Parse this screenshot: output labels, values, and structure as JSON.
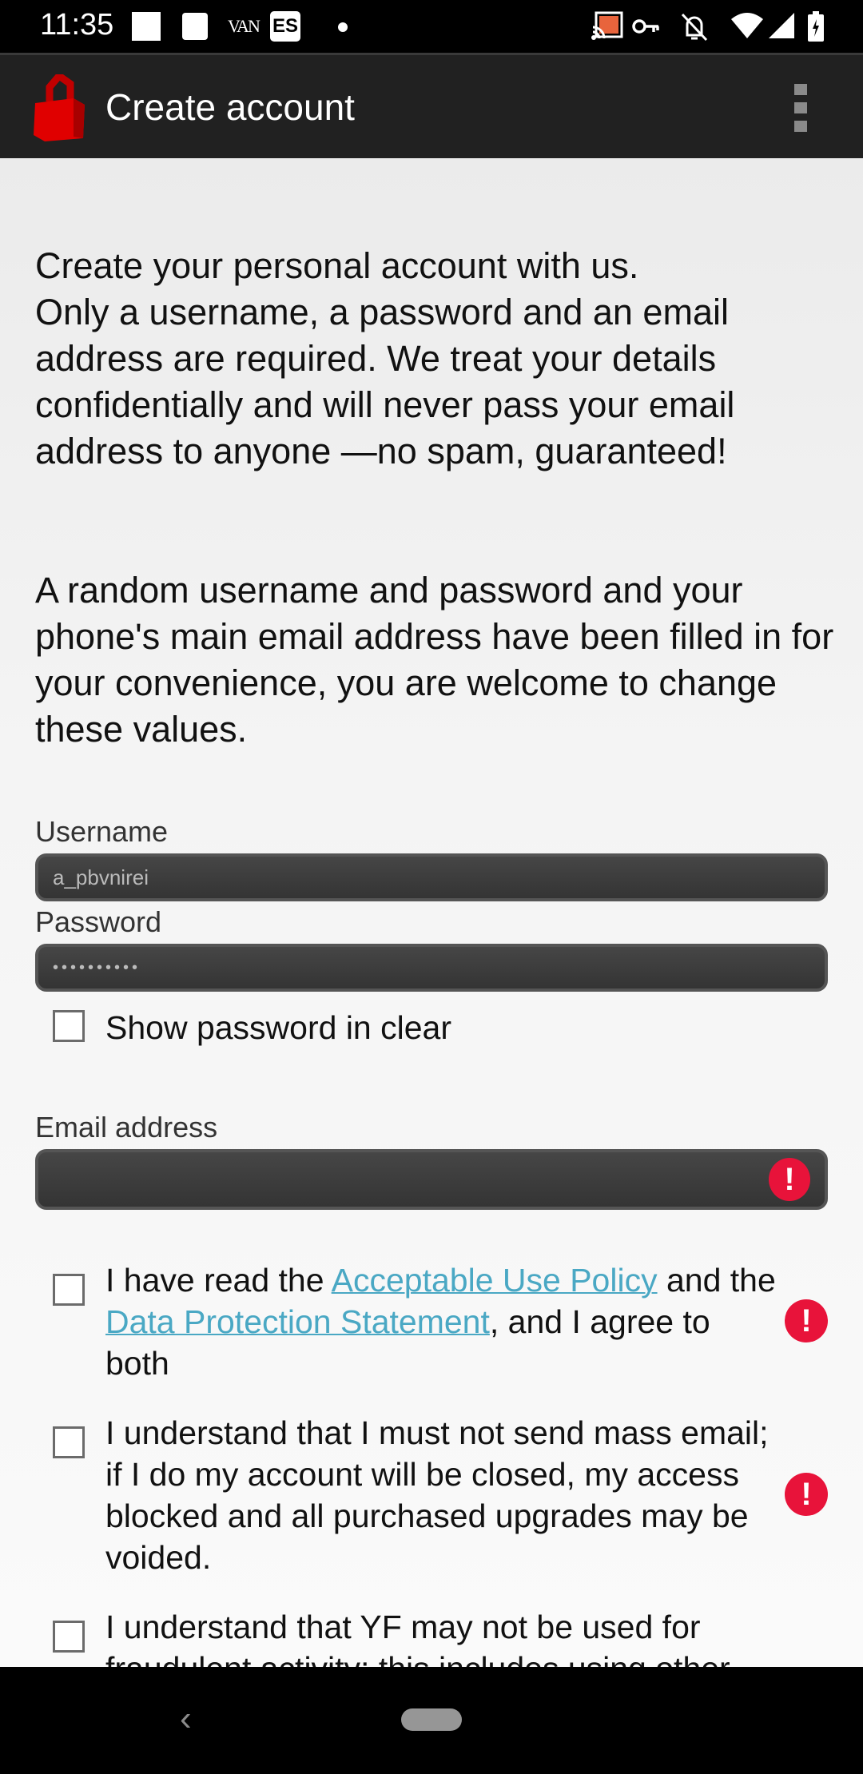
{
  "status_bar": {
    "time": "11:35",
    "van_label": "VAN",
    "es_label": "ES",
    "icons": [
      "notification-square-icon",
      "notification-square-icon",
      "van-icon",
      "es-icon",
      "dot-icon",
      "cast-icon",
      "vpn-key-icon",
      "bell-off-icon",
      "wifi-icon",
      "signal-icon",
      "battery-charging-icon"
    ],
    "cast_color": "#e8643c"
  },
  "app_bar": {
    "title": "Create account",
    "logo_icon": "red-padlock-icon",
    "overflow_icon": "more-vert-icon"
  },
  "intro": {
    "paragraph1": "Create your personal account with us.\nOnly a username, a password and an email address are required. We treat your details confidentially and will never pass your email address to anyone —no spam, guaranteed!",
    "paragraph2": "A random username and password and your phone's main email address have been filled in for your convenience, you are welcome to change these values."
  },
  "form": {
    "username": {
      "label": "Username",
      "value": "a_pbvnirei"
    },
    "password": {
      "label": "Password",
      "value": "••••••••••"
    },
    "show_password": {
      "label": "Show password in clear",
      "checked": false
    },
    "email": {
      "label": "Email address",
      "value": "",
      "error": true
    },
    "agreements": [
      {
        "checked": false,
        "error": true,
        "text_before": "I have read the ",
        "link1": "Acceptable Use Policy",
        "text_mid1": " and the ",
        "link2": "Data Protection Statement",
        "text_after": ", and I agree to both"
      },
      {
        "checked": false,
        "error": true,
        "text": "I understand that I must not send mass email; if I do my account will be closed, my access blocked and all purchased upgrades may be voided."
      },
      {
        "checked": false,
        "error": false,
        "text": "I understand that YF may not be used for fraudulent activity; this includes using other"
      }
    ],
    "error_glyph": "!",
    "error_color": "#e8133a",
    "link_color": "#4aa8c4"
  },
  "nav_bar": {
    "back_glyph": "‹",
    "back_icon": "back-icon",
    "home_icon": "home-pill-icon"
  }
}
